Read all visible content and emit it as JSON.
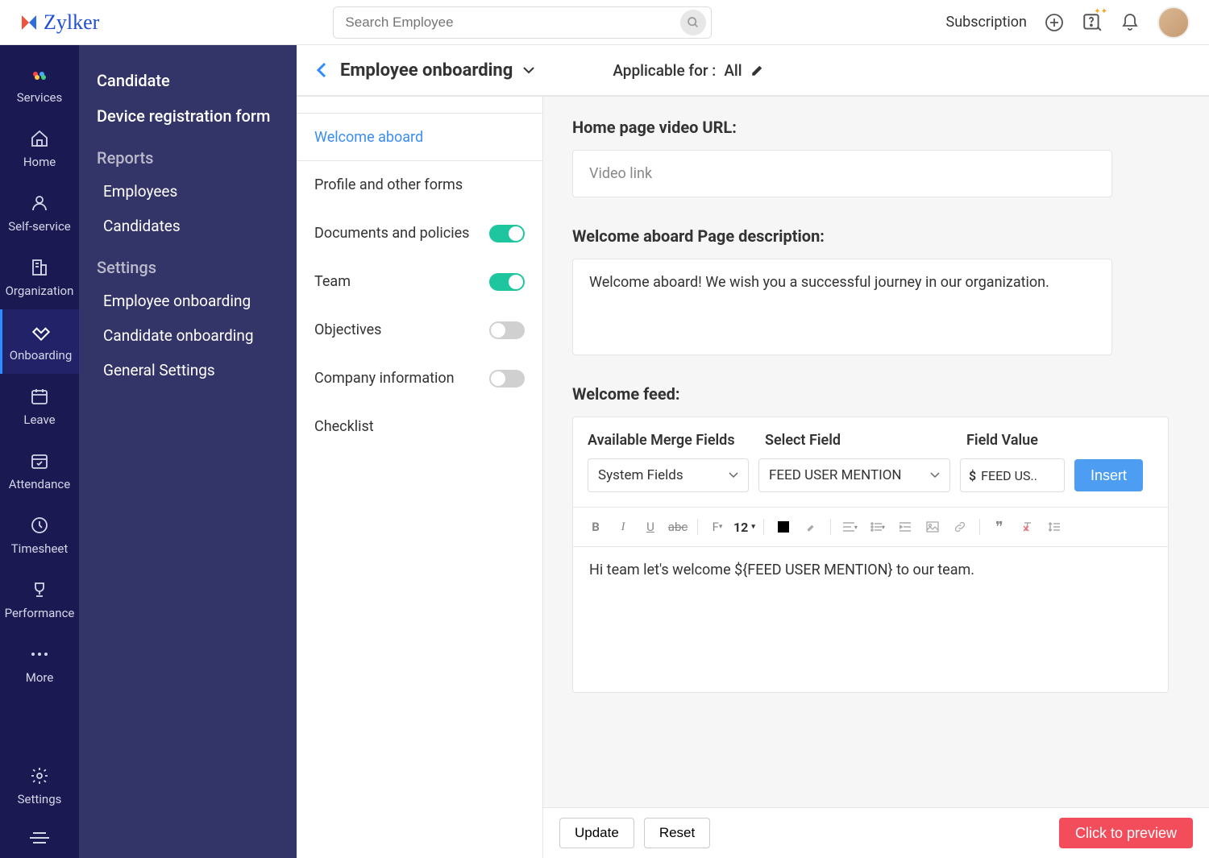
{
  "brand": "Zylker",
  "search": {
    "placeholder": "Search Employee"
  },
  "topbar": {
    "subscription": "Subscription"
  },
  "rail": {
    "items": [
      {
        "label": "Services"
      },
      {
        "label": "Home"
      },
      {
        "label": "Self-service"
      },
      {
        "label": "Organization"
      },
      {
        "label": "Onboarding"
      },
      {
        "label": "Leave"
      },
      {
        "label": "Attendance"
      },
      {
        "label": "Timesheet"
      },
      {
        "label": "Performance"
      },
      {
        "label": "More"
      }
    ],
    "bottom": {
      "label": "Settings"
    }
  },
  "subnav": {
    "top": [
      {
        "label": "Candidate"
      },
      {
        "label": "Device registration form"
      }
    ],
    "reports_header": "Reports",
    "reports": [
      {
        "label": "Employees"
      },
      {
        "label": "Candidates"
      }
    ],
    "settings_header": "Settings",
    "settings": [
      {
        "label": "Employee onboarding"
      },
      {
        "label": "Candidate onboarding"
      },
      {
        "label": "General Settings"
      }
    ]
  },
  "header": {
    "title": "Employee onboarding",
    "applicable_label": "Applicable for :",
    "applicable_value": "All"
  },
  "tabs": [
    {
      "label": "Welcome aboard"
    },
    {
      "label": "Profile and other forms"
    },
    {
      "label": "Documents and policies",
      "toggle": true
    },
    {
      "label": "Team",
      "toggle": true
    },
    {
      "label": "Objectives",
      "toggle": false
    },
    {
      "label": "Company information",
      "toggle": false
    },
    {
      "label": "Checklist"
    }
  ],
  "form": {
    "video_url_label": "Home page video URL:",
    "video_url_placeholder": "Video link",
    "desc_label": "Welcome aboard Page description:",
    "desc_value": "Welcome aboard! We wish you a successful journey in our organization.",
    "feed_label": "Welcome feed:",
    "merge": {
      "col1": "Available Merge Fields",
      "col2": "Select Field",
      "col3": "Field Value",
      "sel1": "System Fields",
      "sel2": "FEED USER MENTION",
      "fv": "FEED US..",
      "insert": "Insert"
    },
    "fontsize": "12",
    "editor_text": "Hi team let's welcome ${FEED USER MENTION} to our team."
  },
  "footer": {
    "update": "Update",
    "reset": "Reset",
    "preview": "Click to preview"
  }
}
